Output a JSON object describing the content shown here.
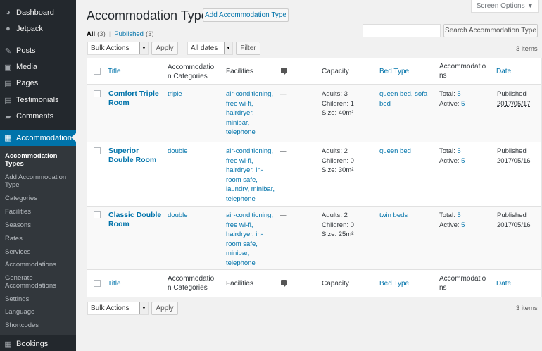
{
  "sidebar": {
    "menu": [
      {
        "label": "Dashboard",
        "icon": "dashboard-icon",
        "glyph": "◕"
      },
      {
        "label": "Jetpack",
        "icon": "jetpack-icon",
        "glyph": "●"
      },
      {
        "label": "Posts",
        "icon": "pin-icon",
        "glyph": "✎"
      },
      {
        "label": "Media",
        "icon": "media-icon",
        "glyph": "▣"
      },
      {
        "label": "Pages",
        "icon": "pages-icon",
        "glyph": "▤"
      },
      {
        "label": "Testimonials",
        "icon": "testimonials-icon",
        "glyph": "▤"
      },
      {
        "label": "Comments",
        "icon": "comments-icon",
        "glyph": "▰"
      },
      {
        "label": "Accommodation",
        "icon": "building-icon",
        "glyph": "▦"
      }
    ],
    "submenu": [
      "Accommodation Types",
      "Add Accommodation Type",
      "Categories",
      "Facilities",
      "Seasons",
      "Rates",
      "Services",
      "Accommodations",
      "Generate Accommodations",
      "Settings",
      "Language",
      "Shortcodes"
    ],
    "bookings": {
      "label": "Bookings",
      "icon": "calendar-icon",
      "glyph": "▦"
    }
  },
  "header": {
    "title": "Accommodation Types",
    "add_button": "Add Accommodation Type",
    "screen_options": "Screen Options ▼"
  },
  "filters": {
    "all_label": "All",
    "all_count": "(3)",
    "separator": "|",
    "published_label": "Published",
    "published_count": "(3)"
  },
  "search": {
    "value": "",
    "button": "Search Accommodation Type"
  },
  "tablenav": {
    "bulk_actions": "Bulk Actions",
    "apply": "Apply",
    "all_dates": "All dates",
    "filter": "Filter",
    "items_count": "3 items"
  },
  "columns": {
    "title": "Title",
    "categories_l1": "Accommodatio",
    "categories_l2": "n Categories",
    "facilities": "Facilities",
    "capacity": "Capacity",
    "bed_type": "Bed Type",
    "accommodations_l1": "Accommodatio",
    "accommodations_l2": "ns",
    "date": "Date"
  },
  "rows": [
    {
      "title_l1": "Comfort Triple",
      "title_l2": "Room",
      "category": "triple",
      "facilities": [
        "air-conditioning,",
        "free wi-fi,",
        "hairdryer,",
        "minibar,",
        "telephone"
      ],
      "comments": "—",
      "capacity": [
        "Adults: 3",
        "Children: 1",
        "Size: 40m²"
      ],
      "bed_type": [
        "queen bed, sofa",
        "bed"
      ],
      "total_label": "Total:",
      "total": "5",
      "active_label": "Active:",
      "active": "5",
      "status": "Published",
      "date": "2017/05/17"
    },
    {
      "title_l1": "Superior",
      "title_l2": "Double Room",
      "category": "double",
      "facilities": [
        "air-conditioning,",
        "free wi-fi,",
        "hairdryer, in-",
        "room safe,",
        "laundry, minibar,",
        "telephone"
      ],
      "comments": "—",
      "capacity": [
        "Adults: 2",
        "Children: 0",
        "Size: 30m²"
      ],
      "bed_type": [
        "queen bed"
      ],
      "total_label": "Total:",
      "total": "5",
      "active_label": "Active:",
      "active": "5",
      "status": "Published",
      "date": "2017/05/16"
    },
    {
      "title_l1": "Classic Double",
      "title_l2": "Room",
      "category": "double",
      "facilities": [
        "air-conditioning,",
        "free wi-fi,",
        "hairdryer, in-",
        "room safe,",
        "minibar,",
        "telephone"
      ],
      "comments": "—",
      "capacity": [
        "Adults: 2",
        "Children: 0",
        "Size: 25m²"
      ],
      "bed_type": [
        "twin beds"
      ],
      "total_label": "Total:",
      "total": "5",
      "active_label": "Active:",
      "active": "5",
      "status": "Published",
      "date": "2017/05/16"
    }
  ]
}
